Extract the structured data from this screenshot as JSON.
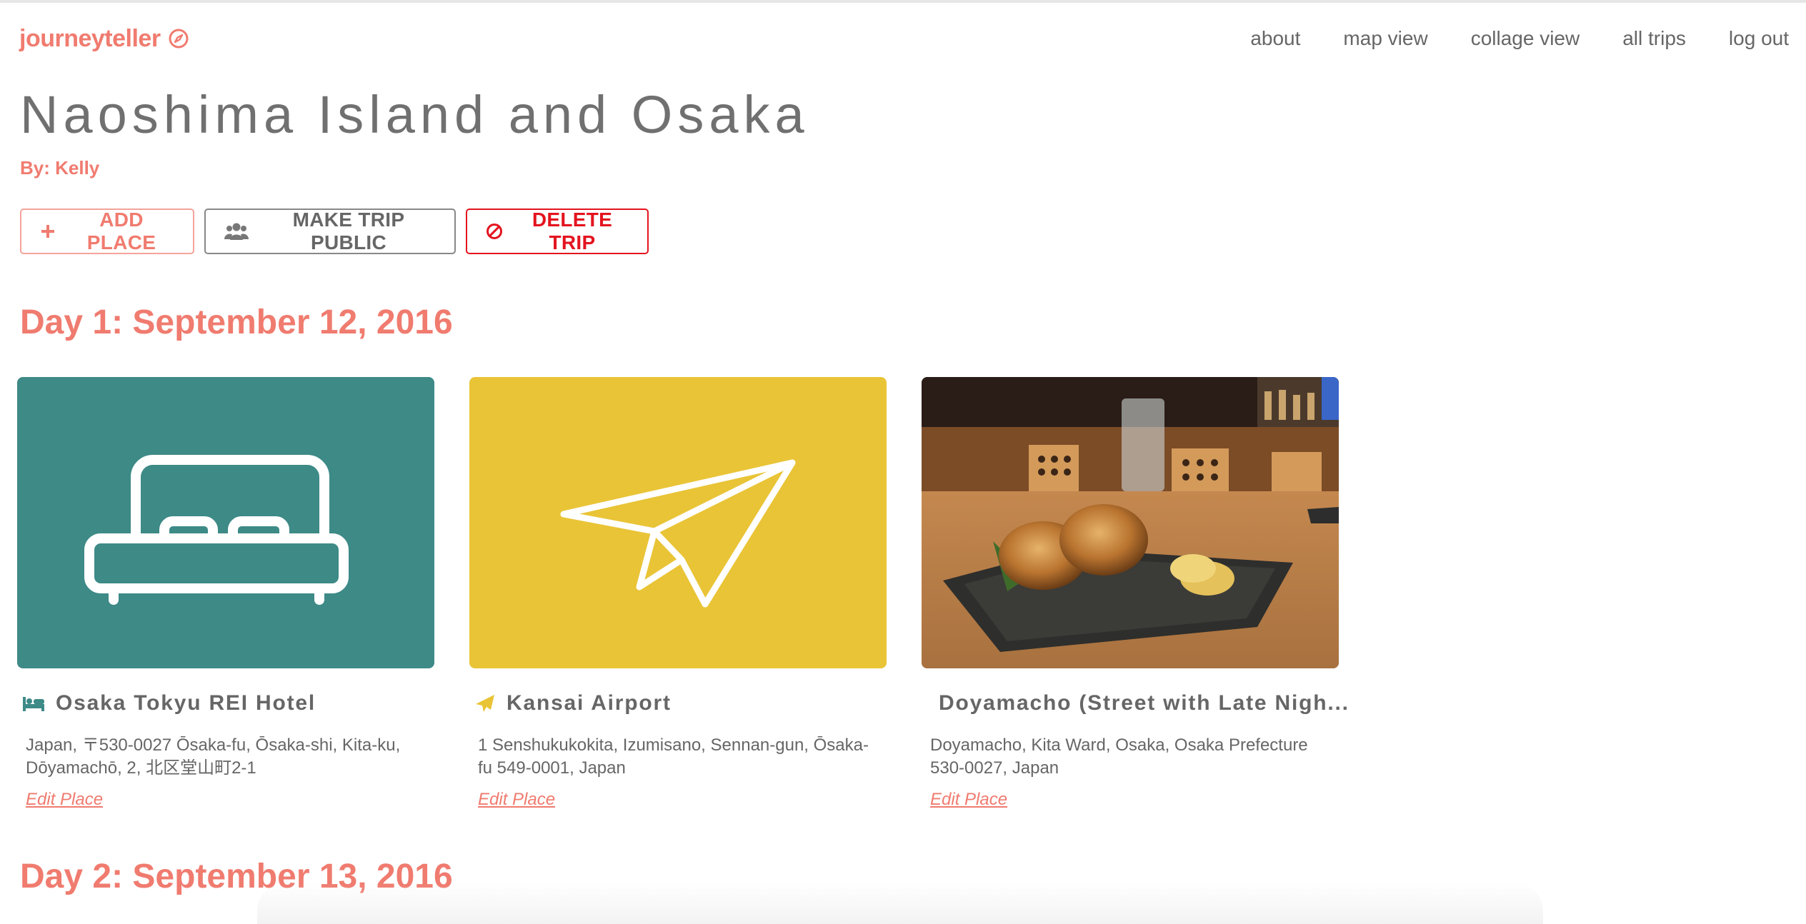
{
  "brand": {
    "name": "journeyteller",
    "icon": "compass-icon",
    "color": "#f07b6f"
  },
  "nav": [
    "about",
    "map view",
    "collage view",
    "all trips",
    "log out"
  ],
  "trip": {
    "title": "Naoshima Island and Osaka",
    "byline": "By: Kelly"
  },
  "actions": {
    "add_place": "ADD PLACE",
    "make_public": "MAKE TRIP PUBLIC",
    "delete_trip": "DELETE TRIP"
  },
  "days": [
    {
      "title": "Day 1: September 12, 2016",
      "places": [
        {
          "name": "Osaka Tokyu REI Hotel",
          "category_icon": "bed-icon",
          "address": "Japan, 〒530-0027 Ōsaka-fu, Ōsaka-shi, Kita-ku, Dōyamachō, 2, 北区堂山町2-1",
          "edit_label": "Edit Place",
          "tile_color": "#3d8a87"
        },
        {
          "name": "Kansai Airport",
          "category_icon": "paper-plane-icon",
          "address": "1 Senshukukokita, Izumisano, Sennan-gun, Ōsaka-fu 549-0001, Japan",
          "edit_label": "Edit Place",
          "tile_color": "#e9c436"
        },
        {
          "name": "Doyamacho (Street with Late Nigh...",
          "category_icon": "fork-knife-icon",
          "address": "Doyamacho, Kita Ward, Osaka, Osaka Prefecture 530-0027, Japan",
          "edit_label": "Edit Place",
          "tile_color": "#8b5a2b"
        }
      ]
    },
    {
      "title": "Day 2: September 13, 2016",
      "places": []
    }
  ]
}
